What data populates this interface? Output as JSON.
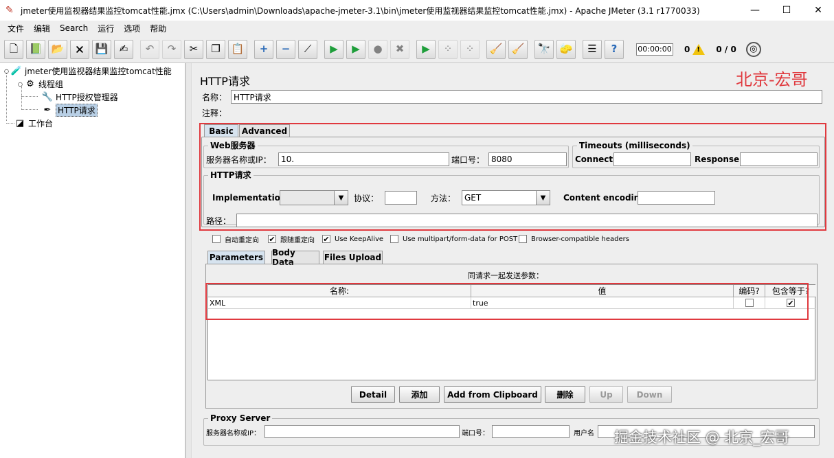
{
  "window": {
    "title": "jmeter使用监视器结果监控tomcat性能.jmx (C:\\Users\\admin\\Downloads\\apache-jmeter-3.1\\bin\\jmeter使用监视器结果监控tomcat性能.jmx) - Apache JMeter (3.1 r1770033)",
    "minimize": "—",
    "maximize": "☐",
    "close": "✕"
  },
  "menu": [
    "文件",
    "编辑",
    "Search",
    "运行",
    "选项",
    "帮助"
  ],
  "toolbar": {
    "timer": "00:00:00",
    "error_count": "0",
    "threads": "0 / 0"
  },
  "tree": {
    "root": "jmeter使用监视器结果监控tomcat性能",
    "thread_group": "线程组",
    "auth_manager": "HTTP授权管理器",
    "http_request": "HTTP请求",
    "workbench": "工作台"
  },
  "panel": {
    "title": "HTTP请求",
    "name_label": "名称：",
    "name_value": "HTTP请求",
    "comment_label": "注释：",
    "tabs": [
      "Basic",
      "Advanced"
    ],
    "web_server": {
      "title": "Web服务器",
      "server_label": "服务器名称或IP：",
      "server_value": "10.",
      "port_label": "端口号：",
      "port_value": "8080"
    },
    "timeouts": {
      "title": "Timeouts (milliseconds)",
      "connect_label": "Connect:",
      "response_label": "Response:"
    },
    "http_request": {
      "title": "HTTP请求",
      "impl_label": "Implementation:",
      "protocol_label": "协议：",
      "method_label": "方法：",
      "method_value": "GET",
      "encoding_label": "Content encoding:",
      "path_label": "路径："
    },
    "options": [
      {
        "label": "自动重定向",
        "checked": false
      },
      {
        "label": "跟随重定向",
        "checked": true
      },
      {
        "label": "Use KeepAlive",
        "checked": true
      },
      {
        "label": "Use multipart/form-data for POST",
        "checked": false
      },
      {
        "label": "Browser-compatible headers",
        "checked": false
      }
    ],
    "param_tabs": [
      "Parameters",
      "Body Data",
      "Files Upload"
    ],
    "params_caption": "同请求一起发送参数：",
    "table": {
      "headers": [
        "名称:",
        "值",
        "编码?",
        "包含等于?"
      ],
      "rows": [
        {
          "name": "XML",
          "value": "true",
          "encode": false,
          "include_equals": true
        }
      ]
    },
    "buttons": [
      "Detail",
      "添加",
      "Add from Clipboard",
      "删除",
      "Up",
      "Down"
    ],
    "proxy": {
      "title": "Proxy Server",
      "server_label": "服务器名称或IP：",
      "port_label": "端口号：",
      "user_label": "用户名"
    }
  },
  "watermark_top": "北京-宏哥",
  "watermark_bottom": "掘金技术社区 @ 北京_宏哥"
}
